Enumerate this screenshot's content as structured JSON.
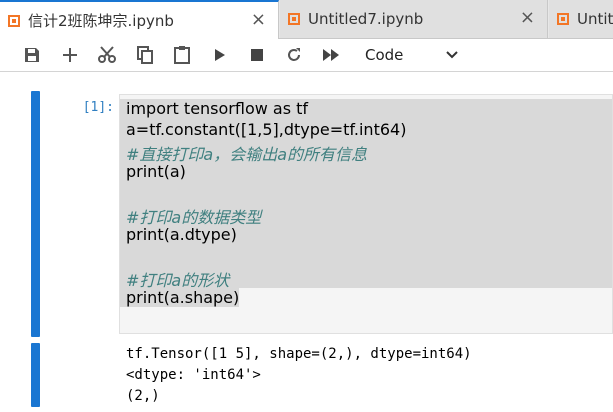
{
  "tabs": [
    {
      "title": "信计2班陈坤宗.ipynb",
      "active": true,
      "close": "×"
    },
    {
      "title": "Untitled7.ipynb",
      "active": false,
      "close": "×"
    },
    {
      "title": "Untit",
      "active": false
    }
  ],
  "toolbar": {
    "buttons": [
      "save-icon",
      "add-icon",
      "cut-icon",
      "copy-icon",
      "paste-icon",
      "run-icon",
      "stop-icon",
      "restart-icon",
      "fast-forward-icon"
    ],
    "cell_type": "Code"
  },
  "cell": {
    "prompt": "[1]:",
    "code_lines": [
      "import tensorflow as tf",
      "a=tf.constant([1,5],dtype=tf.int64)",
      "#直接打印a，会输出a的所有信息",
      "print(a)",
      "",
      "#打印a的数据类型",
      "print(a.dtype)",
      "",
      "#打印a的形状",
      "print(a.shape)"
    ],
    "output_lines": [
      "tf.Tensor([1 5], shape=(2,), dtype=int64)",
      "<dtype: 'int64'>",
      "(2,)"
    ]
  },
  "colors": {
    "accent": "#1976d2",
    "notebook_orange": "#f37626",
    "prompt_blue": "#307fc1"
  }
}
